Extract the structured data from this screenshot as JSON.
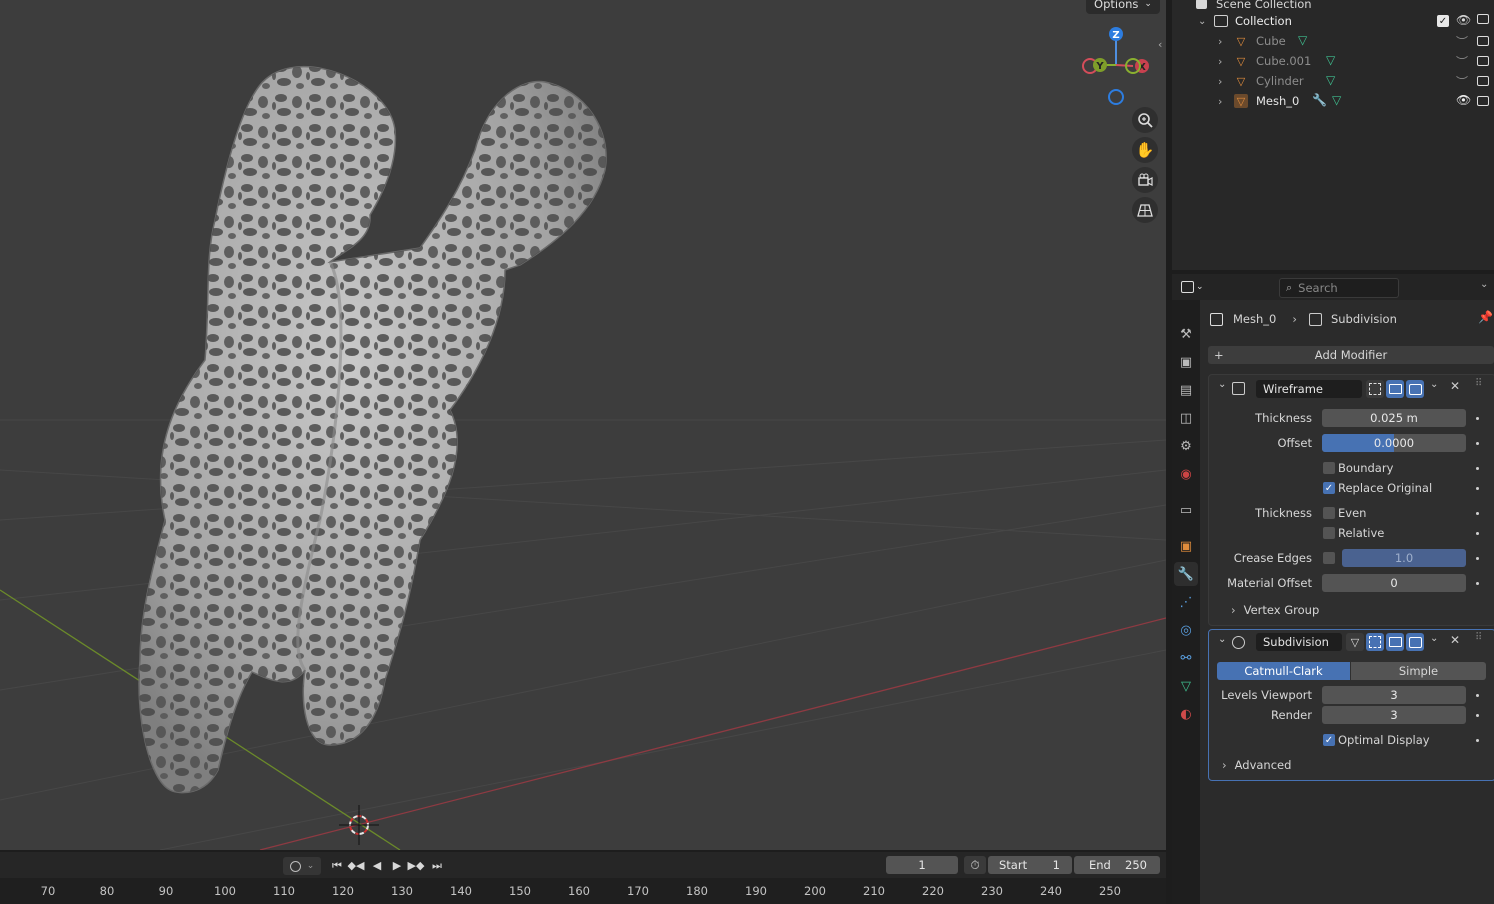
{
  "viewport": {
    "options_label": "Options",
    "gizmo": {
      "z": "Z",
      "y": "Y",
      "x": "X"
    }
  },
  "timeline": {
    "current_frame": "1",
    "start_label": "Start",
    "start_value": "1",
    "end_label": "End",
    "end_value": "250",
    "ruler_numbers": [
      "70",
      "80",
      "90",
      "100",
      "110",
      "120",
      "130",
      "140",
      "150",
      "160",
      "170",
      "180",
      "190",
      "200",
      "210",
      "220",
      "230",
      "240",
      "250"
    ]
  },
  "outliner": {
    "scene_collection": "Scene Collection",
    "collection": "Collection",
    "items": [
      {
        "name": "Cube"
      },
      {
        "name": "Cube.001"
      },
      {
        "name": "Cylinder"
      },
      {
        "name": "Mesh_0"
      }
    ]
  },
  "properties": {
    "search_placeholder": "Search",
    "breadcrumb": {
      "object": "Mesh_0",
      "modifier": "Subdivision"
    },
    "add_modifier": "Add Modifier",
    "wireframe": {
      "name": "Wireframe",
      "thickness_label": "Thickness",
      "thickness_value": "0.025 m",
      "offset_label": "Offset",
      "offset_value": "0.0000",
      "offset_fill": 0.5,
      "boundary_label": "Boundary",
      "boundary_checked": false,
      "replace_original_label": "Replace Original",
      "replace_original_checked": true,
      "thickness2_label": "Thickness",
      "even_label": "Even",
      "even_checked": false,
      "relative_label": "Relative",
      "relative_checked": false,
      "crease_edges_label": "Crease Edges",
      "crease_value": "1.0",
      "material_offset_label": "Material Offset",
      "material_offset_value": "0",
      "vertex_group_label": "Vertex Group"
    },
    "subdivision": {
      "name": "Subdivision",
      "catmull_clark": "Catmull-Clark",
      "simple": "Simple",
      "levels_viewport_label": "Levels Viewport",
      "levels_viewport_value": "3",
      "render_label": "Render",
      "render_value": "3",
      "optimal_display_label": "Optimal Display",
      "optimal_display_checked": true,
      "advanced_label": "Advanced"
    }
  },
  "colors": {
    "accent": "#4772b3",
    "mesh_icon": "#e08c3c",
    "data_icon": "#3fbf8f",
    "wrench": "#5a9fe0"
  }
}
